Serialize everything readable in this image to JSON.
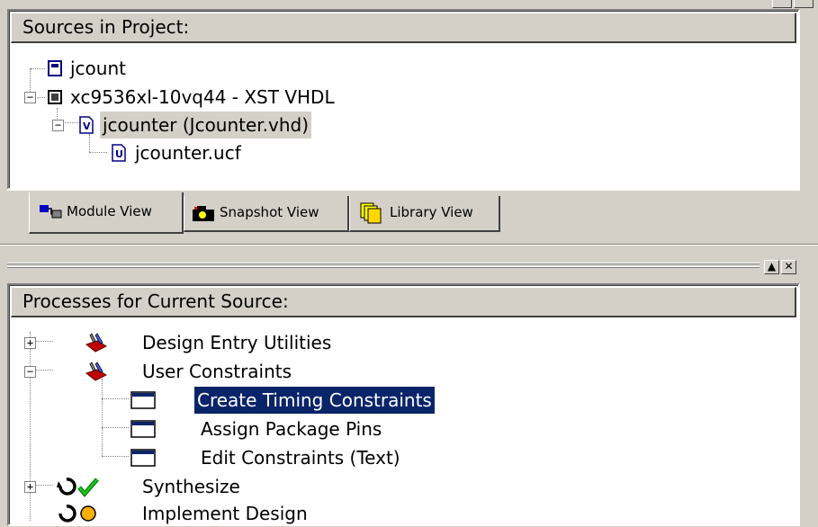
{
  "sources_panel": {
    "title": "Sources in Project:",
    "items": [
      {
        "label": "jcount",
        "icon": "project-icon",
        "level": 0
      },
      {
        "label": "xc9536xl-10vq44 - XST VHDL",
        "icon": "chip-icon",
        "level": 0,
        "expanded": true
      },
      {
        "label": "jcounter (Jcounter.vhd)",
        "icon": "vhdl-file-icon",
        "level": 1,
        "expanded": true
      },
      {
        "label": "jcounter.ucf",
        "icon": "ucf-file-icon",
        "level": 2
      }
    ]
  },
  "tabs": [
    {
      "label": "Module View",
      "icon": "module-view-icon",
      "active": true
    },
    {
      "label": "Snapshot View",
      "icon": "camera-icon",
      "active": false
    },
    {
      "label": "Library View",
      "icon": "library-icon",
      "active": false
    }
  ],
  "processes_panel": {
    "title": "Processes for Current Source:",
    "items": [
      {
        "label": "Design Entry Utilities",
        "icon": "toolbox-icon",
        "expanded": false
      },
      {
        "label": "User Constraints",
        "icon": "toolbox-icon",
        "expanded": true
      },
      {
        "label": "Create Timing Constraints",
        "icon": "window-icon",
        "selected": true
      },
      {
        "label": "Assign Package Pins",
        "icon": "window-icon"
      },
      {
        "label": "Edit Constraints (Text)",
        "icon": "window-icon"
      },
      {
        "label": "Synthesize",
        "icon": "process-ok-icon",
        "expanded": false
      },
      {
        "label": "Implement Design",
        "icon": "process-warning-icon",
        "expanded": false
      }
    ]
  },
  "window_controls": {
    "restore": "▲",
    "close": "✕"
  },
  "expander": {
    "plus": "+",
    "minus": "−"
  },
  "colors": {
    "selection": "#0a246a",
    "face": "#d4d0c8"
  }
}
